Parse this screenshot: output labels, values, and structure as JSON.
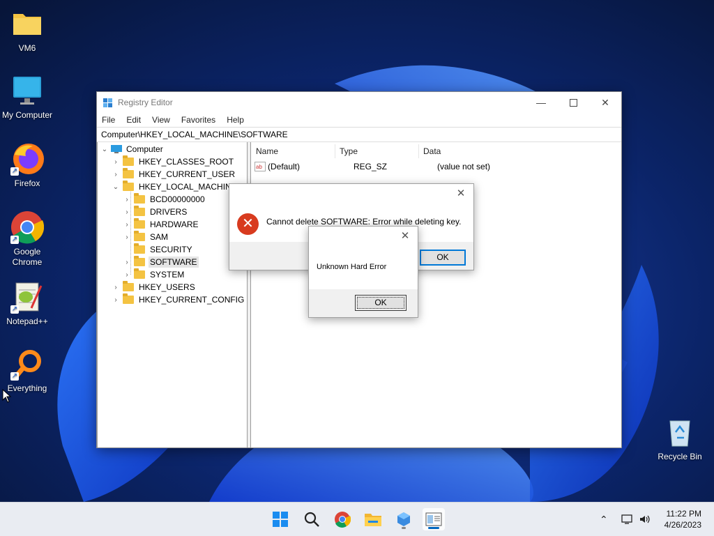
{
  "desktop": {
    "icons": [
      {
        "label": "VM6",
        "icon": "folder-icon"
      },
      {
        "label": "My Computer",
        "icon": "monitor-icon"
      },
      {
        "label": "Firefox",
        "icon": "firefox-icon"
      },
      {
        "label": "Google Chrome",
        "icon": "chrome-icon"
      },
      {
        "label": "Notepad++",
        "icon": "notepadpp-icon"
      },
      {
        "label": "Everything",
        "icon": "everything-search-icon"
      }
    ],
    "recycle_bin": {
      "label": "Recycle Bin",
      "icon": "recycle-bin-icon"
    }
  },
  "registry": {
    "title": "Registry Editor",
    "menu": [
      "File",
      "Edit",
      "View",
      "Favorites",
      "Help"
    ],
    "address": "Computer\\HKEY_LOCAL_MACHINE\\SOFTWARE",
    "tree": {
      "root": "Computer",
      "hkcr": "HKEY_CLASSES_ROOT",
      "hkcu": "HKEY_CURRENT_USER",
      "hklm": "HKEY_LOCAL_MACHINE",
      "hklm_children": [
        "BCD00000000",
        "DRIVERS",
        "HARDWARE",
        "SAM",
        "SECURITY",
        "SOFTWARE",
        "SYSTEM"
      ],
      "hku": "HKEY_USERS",
      "hkcc": "HKEY_CURRENT_CONFIG",
      "selected": "SOFTWARE"
    },
    "columns": {
      "name": "Name",
      "type": "Type",
      "data": "Data"
    },
    "values": [
      {
        "name": "(Default)",
        "type": "REG_SZ",
        "data": "(value not set)",
        "icon": "string-value-icon"
      }
    ]
  },
  "error_dialog": {
    "message": "Cannot delete SOFTWARE:  Error while deleting key.",
    "ok": "OK",
    "close": "✕"
  },
  "hard_error_dialog": {
    "message": "Unknown Hard Error",
    "ok": "OK",
    "close": "✕"
  },
  "taskbar": {
    "time": "11:22 PM",
    "date": "4/26/2023"
  },
  "colors": {
    "accent": "#0078d7",
    "error": "#d83b1f",
    "folder": "#f4c342"
  }
}
